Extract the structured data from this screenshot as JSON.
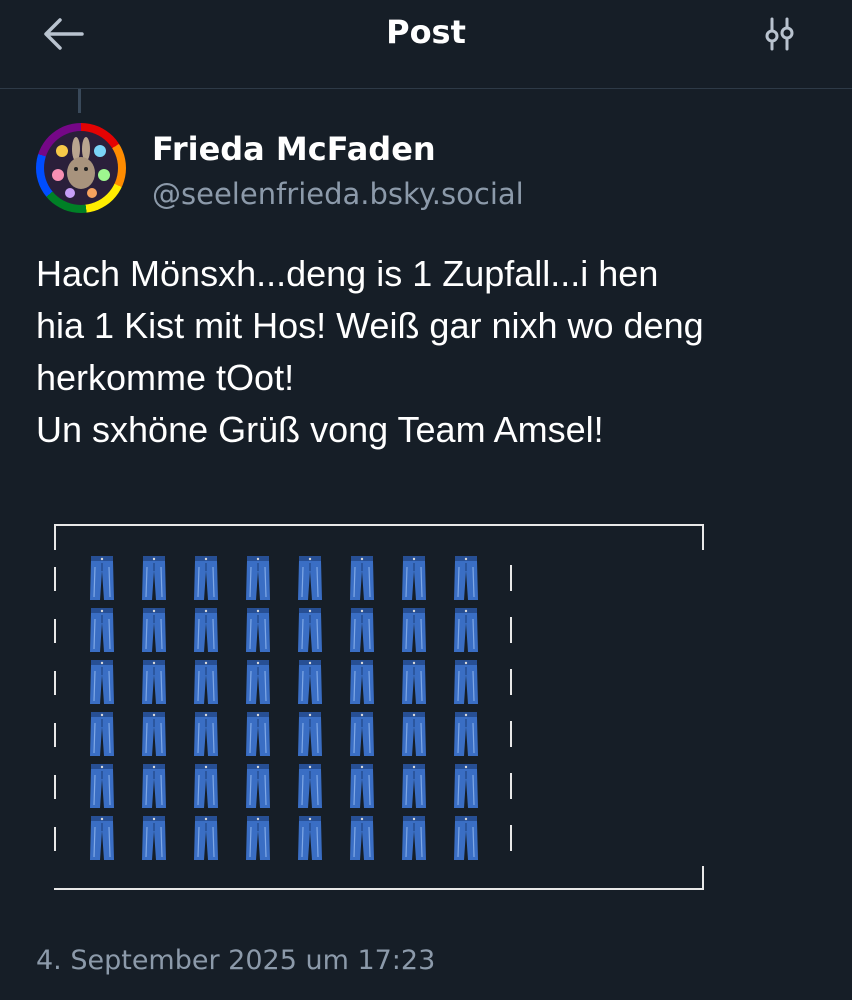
{
  "header": {
    "title": "Post",
    "back_icon": "arrow-left-icon",
    "settings_icon": "sliders-icon"
  },
  "author": {
    "name": "Frieda McFaden",
    "handle": "@seelenfrieda.bsky.social"
  },
  "post": {
    "lines": [
      "Hach Mönsxh...deng is 1 Zupfall...i hen",
      "hia 1 Kist mit Hos! Weiß gar nixh wo deng",
      "herkomme tOot!",
      "Un sxhöne Grüß vong Team Amsel!"
    ],
    "emoji_grid": {
      "emoji": "jeans-icon",
      "rows": 6,
      "cols": 8
    }
  },
  "timestamp": "4. September 2025 um 17:23",
  "colors": {
    "background": "#161e27",
    "text": "#ffffff",
    "muted": "#8c9aaa",
    "jeans_blue": "#3a6ec4"
  }
}
